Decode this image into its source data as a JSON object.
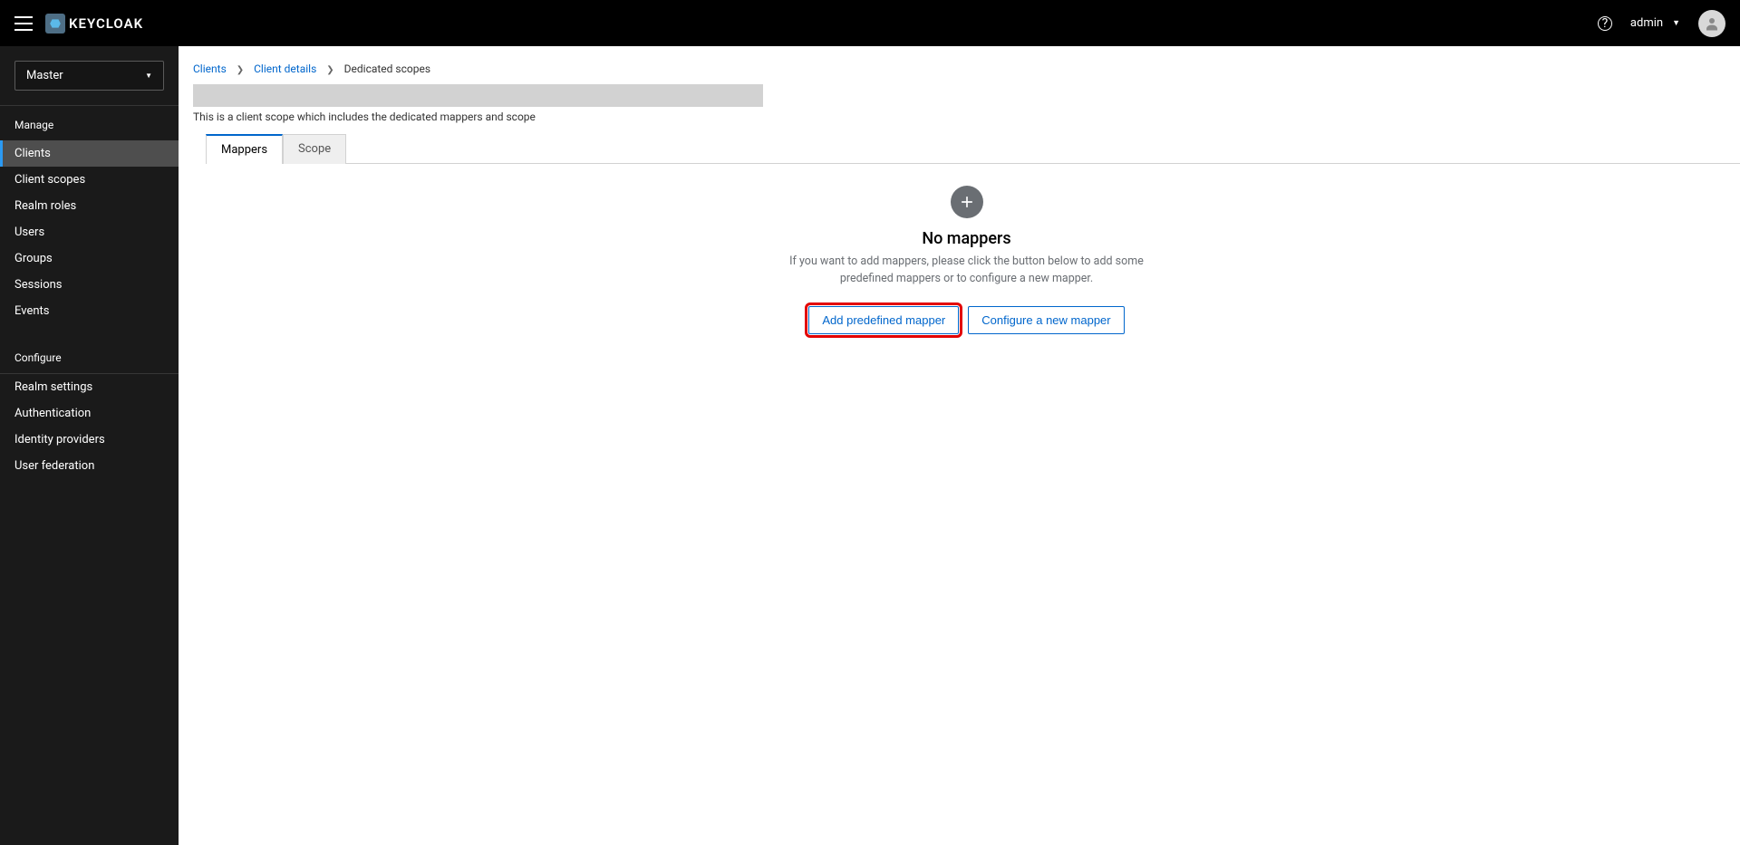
{
  "header": {
    "logo_text": "KEYCLOAK",
    "username": "admin"
  },
  "sidebar": {
    "realm": "Master",
    "manage_label": "Manage",
    "configure_label": "Configure",
    "manage_items": [
      {
        "label": "Clients",
        "active": true
      },
      {
        "label": "Client scopes"
      },
      {
        "label": "Realm roles"
      },
      {
        "label": "Users"
      },
      {
        "label": "Groups"
      },
      {
        "label": "Sessions"
      },
      {
        "label": "Events"
      }
    ],
    "configure_items": [
      {
        "label": "Realm settings"
      },
      {
        "label": "Authentication"
      },
      {
        "label": "Identity providers"
      },
      {
        "label": "User federation"
      }
    ]
  },
  "breadcrumb": {
    "items": [
      {
        "label": "Clients",
        "link": true
      },
      {
        "label": "Client details",
        "link": true
      },
      {
        "label": "Dedicated scopes",
        "link": false
      }
    ]
  },
  "page": {
    "subtitle": "This is a client scope which includes the dedicated mappers and scope",
    "tabs": [
      {
        "label": "Mappers",
        "active": true
      },
      {
        "label": "Scope"
      }
    ],
    "empty": {
      "title": "No mappers",
      "description": "If you want to add mappers, please click the button below to add some predefined mappers or to configure a new mapper.",
      "add_predefined": "Add predefined mapper",
      "configure_new": "Configure a new mapper"
    }
  }
}
